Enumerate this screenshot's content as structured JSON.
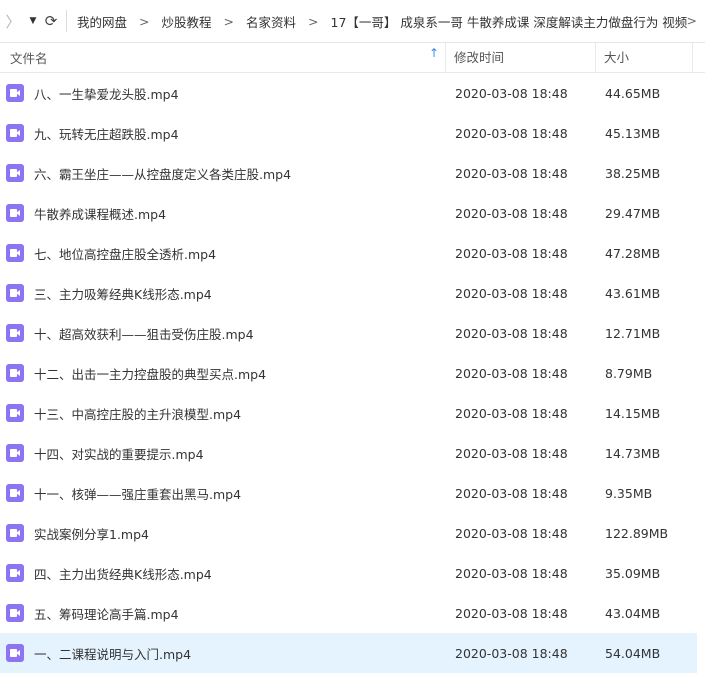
{
  "nav": {
    "back_glyph": "〉",
    "dropdown_glyph": "▼",
    "refresh_glyph": "⟳"
  },
  "breadcrumb": [
    "我的网盘",
    "炒股教程",
    "名家资料",
    "17【一哥】 成泉系一哥 牛散养成课 深度解读主力做盘行为 视频"
  ],
  "breadcrumb_separator": ">",
  "columns": {
    "name": "文件名",
    "date": "修改时间",
    "size": "大小",
    "sort_glyph": "↑"
  },
  "accent_color": "#8c74f2",
  "selected_color": "#e5f3fe",
  "files": [
    {
      "name": "八、一生挚爱龙头股.mp4",
      "date": "2020-03-08 18:48",
      "size": "44.65MB"
    },
    {
      "name": "九、玩转无庄超跌股.mp4",
      "date": "2020-03-08 18:48",
      "size": "45.13MB"
    },
    {
      "name": "六、霸王坐庄——从控盘度定义各类庄股.mp4",
      "date": "2020-03-08 18:48",
      "size": "38.25MB"
    },
    {
      "name": "牛散养成课程概述.mp4",
      "date": "2020-03-08 18:48",
      "size": "29.47MB"
    },
    {
      "name": "七、地位高控盘庄股全透析.mp4",
      "date": "2020-03-08 18:48",
      "size": "47.28MB"
    },
    {
      "name": "三、主力吸筹经典K线形态.mp4",
      "date": "2020-03-08 18:48",
      "size": "43.61MB"
    },
    {
      "name": "十、超高效获利——狙击受伤庄股.mp4",
      "date": "2020-03-08 18:48",
      "size": "12.71MB"
    },
    {
      "name": "十二、出击一主力控盘股的典型买点.mp4",
      "date": "2020-03-08 18:48",
      "size": "8.79MB"
    },
    {
      "name": "十三、中高控庄股的主升浪模型.mp4",
      "date": "2020-03-08 18:48",
      "size": "14.15MB"
    },
    {
      "name": "十四、对实战的重要提示.mp4",
      "date": "2020-03-08 18:48",
      "size": "14.73MB"
    },
    {
      "name": "十一、核弹——强庄重套出黑马.mp4",
      "date": "2020-03-08 18:48",
      "size": "9.35MB"
    },
    {
      "name": "实战案例分享1.mp4",
      "date": "2020-03-08 18:48",
      "size": "122.89MB"
    },
    {
      "name": "四、主力出货经典K线形态.mp4",
      "date": "2020-03-08 18:48",
      "size": "35.09MB"
    },
    {
      "name": "五、筹码理论高手篇.mp4",
      "date": "2020-03-08 18:48",
      "size": "43.04MB"
    },
    {
      "name": "一、二课程说明与入门.mp4",
      "date": "2020-03-08 18:48",
      "size": "54.04MB"
    }
  ]
}
